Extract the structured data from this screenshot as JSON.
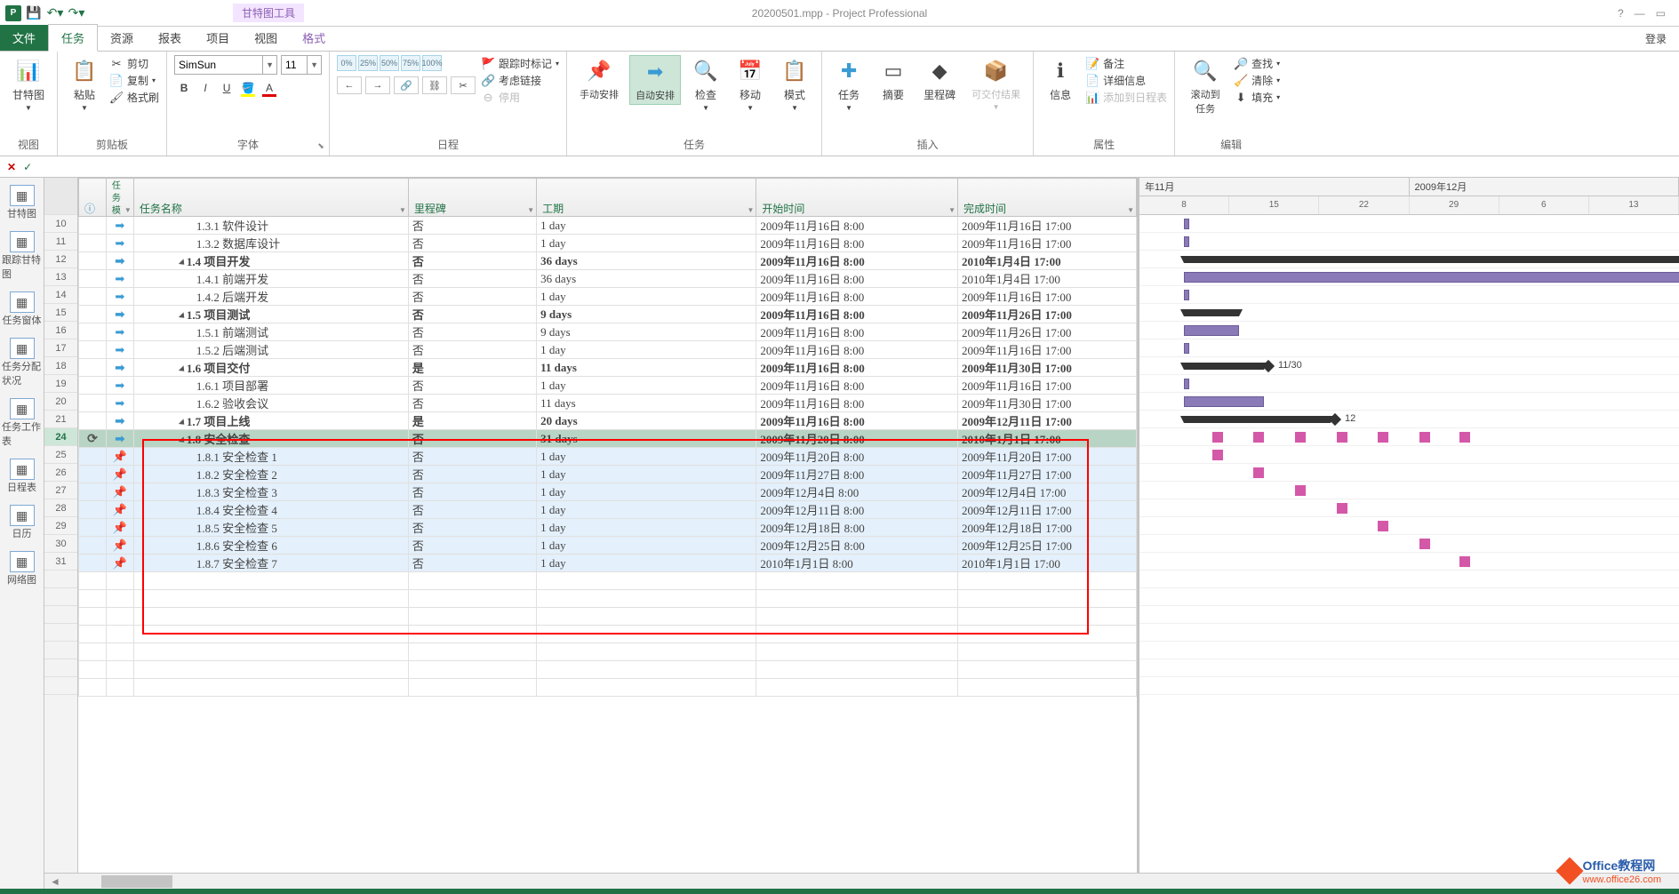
{
  "title": "20200501.mpp - Project Professional",
  "tooltab": "甘特图工具",
  "login": "登录",
  "menutabs": {
    "file": "文件",
    "task": "任务",
    "resource": "资源",
    "report": "报表",
    "project": "项目",
    "view": "视图",
    "format": "格式"
  },
  "ribbon": {
    "view": {
      "gantt": "甘特图",
      "label": "视图"
    },
    "clipboard": {
      "paste": "粘贴",
      "cut": "剪切",
      "copy": "复制",
      "fmtpaint": "格式刷",
      "label": "剪贴板"
    },
    "font": {
      "name": "SimSun",
      "size": "11",
      "label": "字体"
    },
    "schedule": {
      "track": "跟踪时标记",
      "respect": "考虑链接",
      "stop": "停用",
      "label": "日程",
      "pcts": [
        "0%",
        "25%",
        "50%",
        "75%",
        "100%"
      ]
    },
    "tasks": {
      "manual": "手动安排",
      "auto": "自动安排",
      "inspect": "检查",
      "move": "移动",
      "mode": "模式",
      "label": "任务"
    },
    "insert": {
      "task": "任务",
      "summary": "摘要",
      "milestone": "里程碑",
      "deliverable": "可交付结果",
      "label": "插入"
    },
    "props": {
      "info": "信息",
      "notes": "备注",
      "details": "详细信息",
      "addtl": "添加到日程表",
      "label": "属性"
    },
    "edit": {
      "scroll": "滚动到任务",
      "find": "查找",
      "clear": "清除",
      "fill": "填充",
      "label": "编辑"
    }
  },
  "leftviews": [
    "甘特图",
    "跟踪甘特图",
    "任务窗体",
    "任务分配状况",
    "任务工作表",
    "日程表",
    "日历",
    "网络图"
  ],
  "columns": {
    "mode": "任务模",
    "name": "任务名称",
    "milestone": "里程碑",
    "duration": "工期",
    "start": "开始时间",
    "finish": "完成时间"
  },
  "gantt_hdr": {
    "left": "年11月",
    "right": "2009年12月",
    "days": [
      "8",
      "15",
      "22",
      "29",
      "6",
      "13"
    ]
  },
  "rows": [
    {
      "num": "10",
      "mode": "auto",
      "ind": 3,
      "wbs": "1.3.1",
      "name": "软件设计",
      "mile": "否",
      "dur": "1 day",
      "start": "2009年11月16日 8:00",
      "fin": "2009年11月16日 17:00",
      "gbar": [
        50,
        6
      ]
    },
    {
      "num": "11",
      "mode": "auto",
      "ind": 3,
      "wbs": "1.3.2",
      "name": "数据库设计",
      "mile": "否",
      "dur": "1 day",
      "start": "2009年11月16日 8:00",
      "fin": "2009年11月16日 17:00",
      "gbar": [
        50,
        6
      ]
    },
    {
      "num": "12",
      "mode": "auto",
      "ind": 2,
      "wbs": "1.4",
      "name": "项目开发",
      "sum": true,
      "mile": "否",
      "dur": "36 days",
      "start": "2009年11月16日 8:00",
      "fin": "2010年1月4日 17:00",
      "gsum": [
        50,
        600
      ]
    },
    {
      "num": "13",
      "mode": "auto",
      "ind": 3,
      "wbs": "1.4.1",
      "name": "前端开发",
      "mile": "否",
      "dur": "36 days",
      "start": "2009年11月16日 8:00",
      "fin": "2010年1月4日 17:00",
      "gbar": [
        50,
        600
      ]
    },
    {
      "num": "14",
      "mode": "auto",
      "ind": 3,
      "wbs": "1.4.2",
      "name": "后端开发",
      "mile": "否",
      "dur": "1 day",
      "start": "2009年11月16日 8:00",
      "fin": "2009年11月16日 17:00",
      "gbar": [
        50,
        6
      ]
    },
    {
      "num": "15",
      "mode": "auto",
      "ind": 2,
      "wbs": "1.5",
      "name": "项目测试",
      "sum": true,
      "mile": "否",
      "dur": "9 days",
      "start": "2009年11月16日 8:00",
      "fin": "2009年11月26日 17:00",
      "gsum": [
        50,
        62
      ]
    },
    {
      "num": "16",
      "mode": "auto",
      "ind": 3,
      "wbs": "1.5.1",
      "name": "前端测试",
      "mile": "否",
      "dur": "9 days",
      "start": "2009年11月16日 8:00",
      "fin": "2009年11月26日 17:00",
      "gbar": [
        50,
        62
      ]
    },
    {
      "num": "17",
      "mode": "auto",
      "ind": 3,
      "wbs": "1.5.2",
      "name": "后端测试",
      "mile": "否",
      "dur": "1 day",
      "start": "2009年11月16日 8:00",
      "fin": "2009年11月16日 17:00",
      "gbar": [
        50,
        6
      ]
    },
    {
      "num": "18",
      "mode": "auto",
      "ind": 2,
      "wbs": "1.6",
      "name": "项目交付",
      "sum": true,
      "mile": "是",
      "dur": "11 days",
      "start": "2009年11月16日 8:00",
      "fin": "2009年11月30日 17:00",
      "gsum": [
        50,
        90
      ],
      "dia": 140,
      "dlabel": "11/30"
    },
    {
      "num": "19",
      "mode": "auto",
      "ind": 3,
      "wbs": "1.6.1",
      "name": "项目部署",
      "mile": "否",
      "dur": "1 day",
      "start": "2009年11月16日 8:00",
      "fin": "2009年11月16日 17:00",
      "gbar": [
        50,
        6
      ]
    },
    {
      "num": "20",
      "mode": "auto",
      "ind": 3,
      "wbs": "1.6.2",
      "name": "验收会议",
      "mile": "否",
      "dur": "11 days",
      "start": "2009年11月16日 8:00",
      "fin": "2009年11月30日 17:00",
      "gbar": [
        50,
        90
      ]
    },
    {
      "num": "21",
      "mode": "auto",
      "ind": 2,
      "wbs": "1.7",
      "name": "项目上线",
      "sum": true,
      "mile": "是",
      "dur": "20 days",
      "start": "2009年11月16日 8:00",
      "fin": "2009年12月11日 17:00",
      "gsum": [
        50,
        165
      ],
      "dia": 215,
      "dlabel": "12"
    },
    {
      "num": "24",
      "mode": "auto",
      "ind": 2,
      "wbs": "1.8",
      "name": "安全检查",
      "sum": true,
      "sel": true,
      "cyc": true,
      "mile": "否",
      "dur": "31 days",
      "start": "2009年11月20日 8:00",
      "fin": "2010年1月1日 17:00",
      "pinks": [
        82,
        128,
        175,
        222,
        268,
        315,
        360
      ]
    },
    {
      "num": "25",
      "mode": "pin",
      "ind": 3,
      "wbs": "1.8.1",
      "name": "安全检查 1",
      "hl": true,
      "mile": "否",
      "dur": "1 day",
      "start": "2009年11月20日 8:00",
      "fin": "2009年11月20日 17:00",
      "pinks": [
        82
      ]
    },
    {
      "num": "26",
      "mode": "pin",
      "ind": 3,
      "wbs": "1.8.2",
      "name": "安全检查 2",
      "hl": true,
      "mile": "否",
      "dur": "1 day",
      "start": "2009年11月27日 8:00",
      "fin": "2009年11月27日 17:00",
      "pinks": [
        128
      ]
    },
    {
      "num": "27",
      "mode": "pin",
      "ind": 3,
      "wbs": "1.8.3",
      "name": "安全检查 3",
      "hl": true,
      "mile": "否",
      "dur": "1 day",
      "start": "2009年12月4日 8:00",
      "fin": "2009年12月4日 17:00",
      "pinks": [
        175
      ]
    },
    {
      "num": "28",
      "mode": "pin",
      "ind": 3,
      "wbs": "1.8.4",
      "name": "安全检查 4",
      "hl": true,
      "mile": "否",
      "dur": "1 day",
      "start": "2009年12月11日 8:00",
      "fin": "2009年12月11日 17:00",
      "pinks": [
        222
      ]
    },
    {
      "num": "29",
      "mode": "pin",
      "ind": 3,
      "wbs": "1.8.5",
      "name": "安全检查 5",
      "hl": true,
      "mile": "否",
      "dur": "1 day",
      "start": "2009年12月18日 8:00",
      "fin": "2009年12月18日 17:00",
      "pinks": [
        268
      ]
    },
    {
      "num": "30",
      "mode": "pin",
      "ind": 3,
      "wbs": "1.8.6",
      "name": "安全检查 6",
      "hl": true,
      "mile": "否",
      "dur": "1 day",
      "start": "2009年12月25日 8:00",
      "fin": "2009年12月25日 17:00",
      "pinks": [
        315
      ]
    },
    {
      "num": "31",
      "mode": "pin",
      "ind": 3,
      "wbs": "1.8.7",
      "name": "安全检查 7",
      "hl": true,
      "mile": "否",
      "dur": "1 day",
      "start": "2010年1月1日 8:00",
      "fin": "2010年1月1日 17:00",
      "pinks": [
        360
      ]
    }
  ],
  "watermark": {
    "brand": "Office教程网",
    "url": "www.office26.com"
  }
}
